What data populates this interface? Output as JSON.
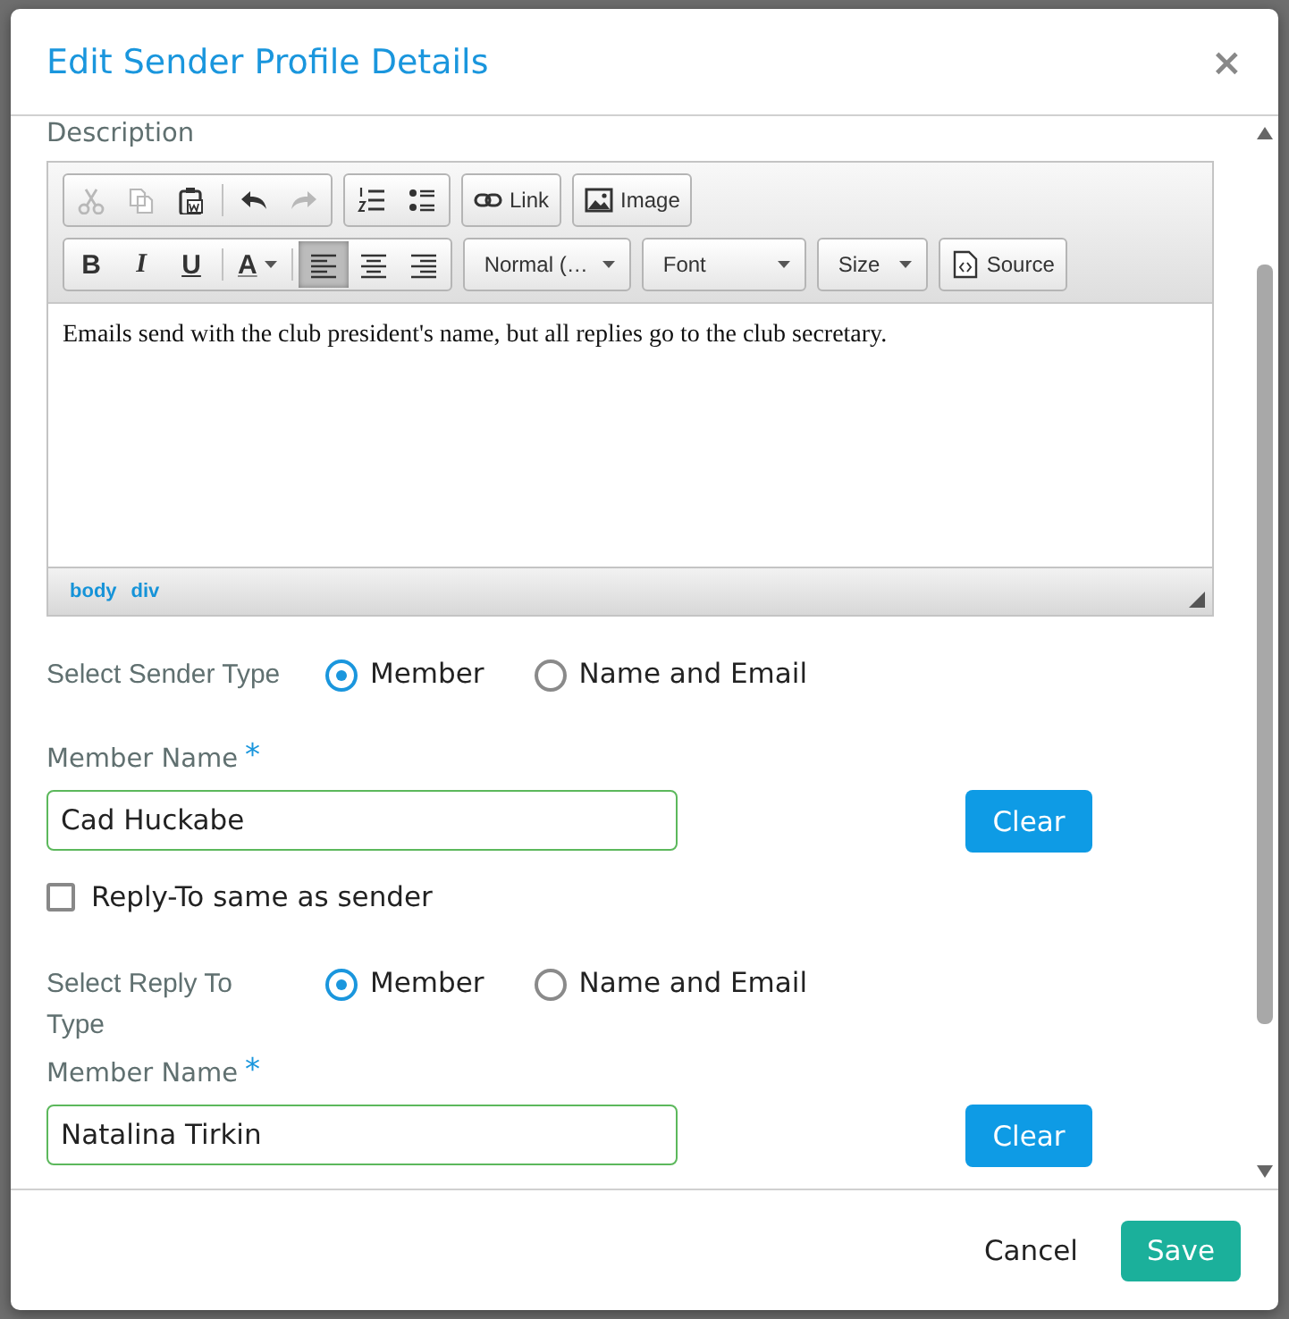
{
  "dialog": {
    "title": "Edit Sender Profile Details",
    "close": "×"
  },
  "description": {
    "label": "Description",
    "toolbar": [
      [
        [
          {
            "kind": "cut",
            "disabled": true
          },
          {
            "kind": "copy",
            "disabled": true
          },
          {
            "kind": "paste-word",
            "disabled": false
          },
          {
            "kind": "separator"
          },
          {
            "kind": "undo",
            "disabled": false
          },
          {
            "kind": "redo",
            "disabled": true
          }
        ],
        [
          {
            "kind": "numbered-list",
            "disabled": false
          },
          {
            "kind": "bullet-list",
            "disabled": false
          }
        ],
        [
          {
            "kind": "link",
            "label": "Link",
            "disabled": false
          }
        ],
        [
          {
            "kind": "image",
            "label": "Image",
            "disabled": false
          }
        ]
      ],
      [
        [
          {
            "kind": "bold",
            "label": "B",
            "selected": false
          },
          {
            "kind": "italic",
            "label": "I",
            "selected": false
          },
          {
            "kind": "underline",
            "label": "U",
            "selected": false
          },
          {
            "kind": "separator"
          },
          {
            "kind": "text-color",
            "label": "A",
            "selected": false
          },
          {
            "kind": "separator"
          },
          {
            "kind": "align-left",
            "selected": true
          },
          {
            "kind": "align-center",
            "selected": false
          },
          {
            "kind": "align-right",
            "selected": false
          }
        ],
        [
          {
            "kind": "dropdown",
            "label": "Normal (…"
          }
        ],
        [
          {
            "kind": "dropdown",
            "label": "Font"
          }
        ],
        [
          {
            "kind": "dropdown",
            "label": "Size"
          }
        ],
        [
          {
            "kind": "source",
            "label": "Source",
            "disabled": false
          }
        ]
      ]
    ],
    "content": "Emails send with the club president's name, but all replies go to the club secretary.",
    "path": [
      "body",
      "div"
    ]
  },
  "sender_type": {
    "label": "Select Sender Type",
    "options": [
      {
        "label": "Member",
        "selected": true
      },
      {
        "label": "Name and Email",
        "selected": false
      }
    ]
  },
  "sender_member": {
    "label": "Member Name",
    "required_mark": "*",
    "value": "Cad Huckabe",
    "clear": "Clear"
  },
  "reply_same": {
    "label": "Reply-To same as sender",
    "checked": false
  },
  "reply_type": {
    "label": "Select Reply To Type",
    "options": [
      {
        "label": "Member",
        "selected": true
      },
      {
        "label": "Name and Email",
        "selected": false
      }
    ]
  },
  "reply_member": {
    "label": "Member Name",
    "required_mark": "*",
    "value": "Natalina Tirkin",
    "clear": "Clear"
  },
  "footer": {
    "cancel": "Cancel",
    "save": "Save"
  }
}
